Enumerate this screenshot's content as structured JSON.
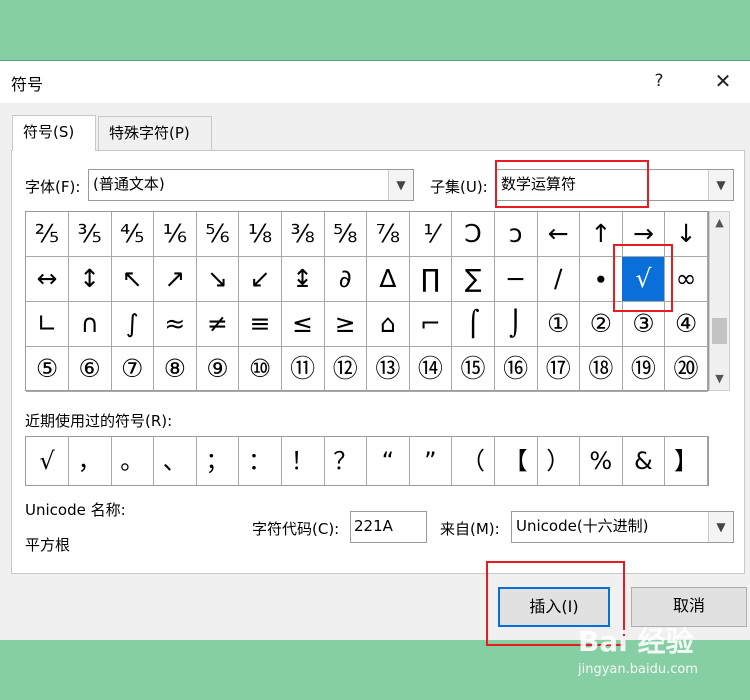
{
  "dialog": {
    "title": "符号",
    "help": "?",
    "close": "✕"
  },
  "tabs": [
    {
      "label": "符号(S)"
    },
    {
      "label": "特殊字符(P)"
    }
  ],
  "font": {
    "label": "字体(F):",
    "value": "(普通文本)"
  },
  "subset": {
    "label": "子集(U):",
    "value": "数学运算符"
  },
  "symbols": [
    [
      "⅖",
      "⅗",
      "⅘",
      "⅙",
      "⅚",
      "⅛",
      "⅜",
      "⅝",
      "⅞",
      "⅟",
      "Ↄ",
      "ↄ",
      "←",
      "↑",
      "→",
      "↓"
    ],
    [
      "↔",
      "↕",
      "↖",
      "↗",
      "↘",
      "↙",
      "↨",
      "∂",
      "∆",
      "∏",
      "∑",
      "−",
      "∕",
      "∙",
      "√",
      "∞"
    ],
    [
      "∟",
      "∩",
      "∫",
      "≈",
      "≠",
      "≡",
      "≤",
      "≥",
      "⌂",
      "⌐",
      "⌠",
      "⌡",
      "①",
      "②",
      "③",
      "④"
    ],
    [
      "⑤",
      "⑥",
      "⑦",
      "⑧",
      "⑨",
      "⑩",
      "⑪",
      "⑫",
      "⑬",
      "⑭",
      "⑮",
      "⑯",
      "⑰",
      "⑱",
      "⑲",
      "⑳"
    ]
  ],
  "selected_symbol": "√",
  "recent": {
    "label": "近期使用过的符号(R):",
    "items": [
      "√",
      "，",
      "。",
      "、",
      "；",
      "：",
      "！",
      "？",
      "“",
      "”",
      "（",
      "【",
      "）",
      "%",
      "&",
      "】"
    ]
  },
  "unicode": {
    "name_label": "Unicode 名称:",
    "name_value": "平方根",
    "code_label": "字符代码(C):",
    "code_value": "221A",
    "from_label": "来自(M):",
    "from_value": "Unicode(十六进制)"
  },
  "buttons": {
    "insert": "插入(I)",
    "cancel": "取消"
  },
  "watermark": {
    "logo": "Bai 经验",
    "url": "jingyan.baidu.com"
  },
  "colors": {
    "highlight": "#e81b23",
    "selection": "#0a6fd8",
    "background": "#86cea3"
  }
}
